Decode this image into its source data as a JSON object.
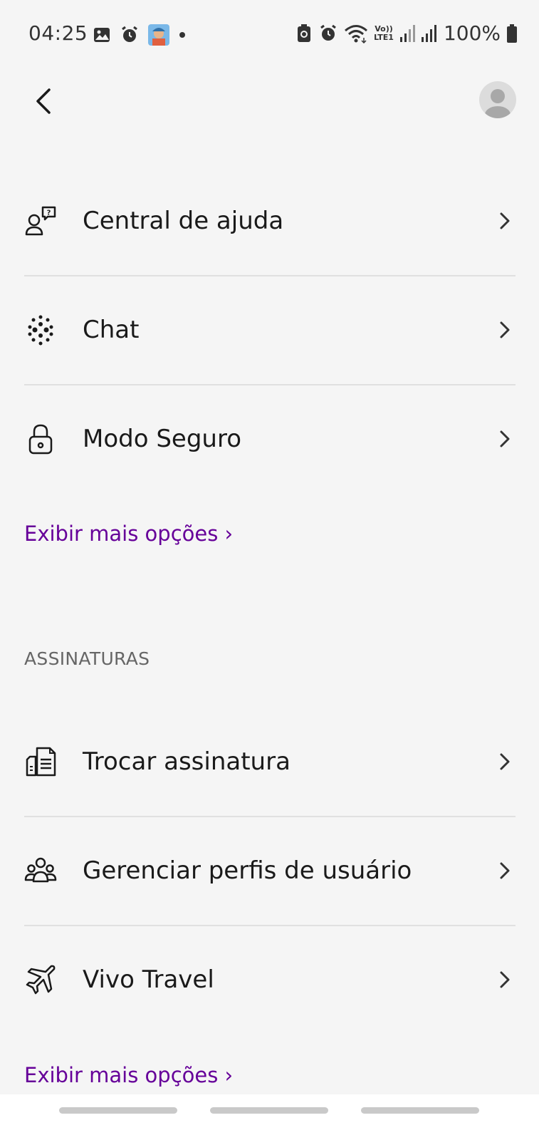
{
  "status_bar": {
    "time": "04:25",
    "battery": "100%",
    "network_label_top": "Vo))",
    "network_label_bottom": "LTE1"
  },
  "header": {
    "back_icon": "chevron-left-icon",
    "avatar_icon": "user-avatar-icon"
  },
  "help_section": {
    "items": [
      {
        "label": "Central de ajuda",
        "icon": "help-center-icon"
      },
      {
        "label": "Chat",
        "icon": "chat-dots-icon"
      },
      {
        "label": "Modo Seguro",
        "icon": "lock-icon"
      }
    ],
    "more_link": "Exibir mais opções ›"
  },
  "subscriptions_section": {
    "title": "ASSINATURAS",
    "items": [
      {
        "label": "Trocar assinatura",
        "icon": "documents-icon"
      },
      {
        "label": "Gerenciar perfis de usuário",
        "icon": "users-icon"
      },
      {
        "label": "Vivo Travel",
        "icon": "airplane-icon"
      }
    ],
    "more_link": "Exibir mais opções ›"
  },
  "colors": {
    "background": "#f5f5f5",
    "accent": "#660099",
    "divider": "#e0e0e0"
  }
}
